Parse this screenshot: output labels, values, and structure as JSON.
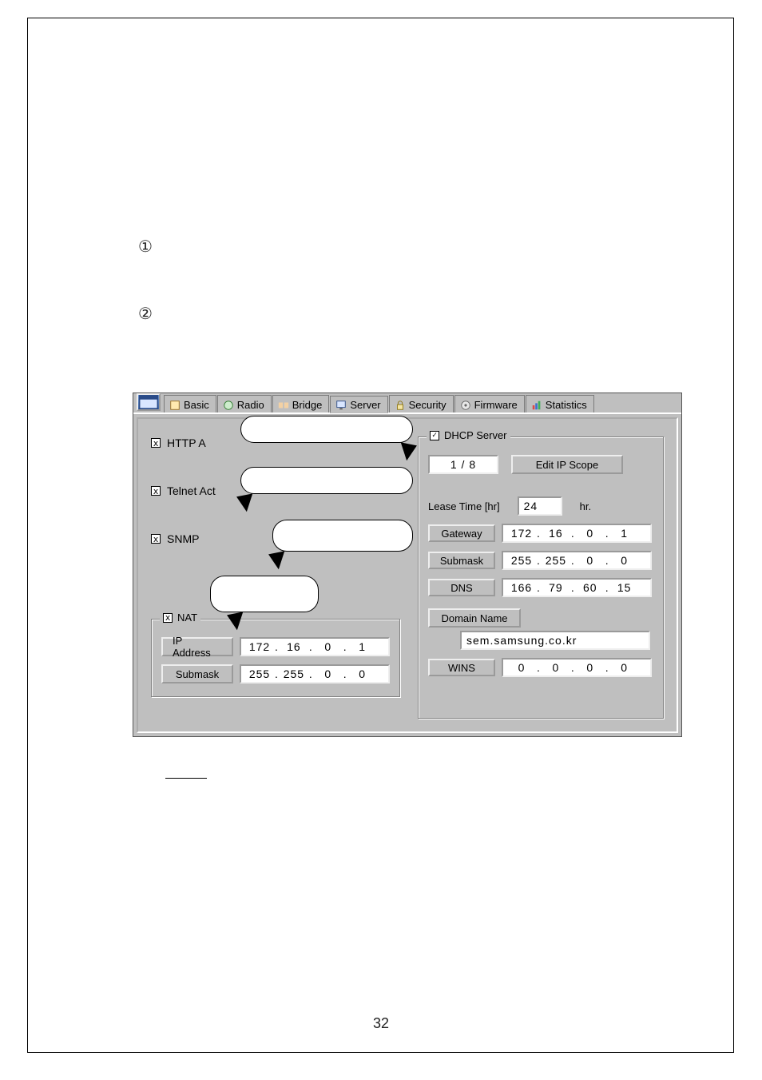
{
  "page_number": "32",
  "markers": {
    "m1": "①",
    "m2": "②"
  },
  "tabs": [
    {
      "label": "Basic"
    },
    {
      "label": "Radio"
    },
    {
      "label": "Bridge"
    },
    {
      "label": "Server"
    },
    {
      "label": "Security"
    },
    {
      "label": "Firmware"
    },
    {
      "label": "Statistics"
    }
  ],
  "left": {
    "http_label": "HTTP A",
    "telnet_label": "Telnet Act",
    "snmp_label": "SNMP",
    "nat_label": "NAT",
    "ip_addr_label": "IP Address",
    "ip_addr_value": {
      "a": "172",
      "b": "16",
      "c": "0",
      "d": "1"
    },
    "submask_label": "Submask",
    "submask_value": {
      "a": "255",
      "b": "255",
      "c": "0",
      "d": "0"
    }
  },
  "right": {
    "dhcp_label": "DHCP Server",
    "scope_count": "1 / 8",
    "edit_scope_label": "Edit IP Scope",
    "lease_label": "Lease Time [hr]",
    "lease_value": "24",
    "lease_unit": "hr.",
    "gateway_label": "Gateway",
    "gateway_value": {
      "a": "172",
      "b": "16",
      "c": "0",
      "d": "1"
    },
    "submask_label": "Submask",
    "submask_value": {
      "a": "255",
      "b": "255",
      "c": "0",
      "d": "0"
    },
    "dns_label": "DNS",
    "dns_value": {
      "a": "166",
      "b": "79",
      "c": "60",
      "d": "15"
    },
    "domain_label": "Domain Name",
    "domain_value": "sem.samsung.co.kr",
    "wins_label": "WINS",
    "wins_value": {
      "a": "0",
      "b": "0",
      "c": "0",
      "d": "0"
    }
  }
}
